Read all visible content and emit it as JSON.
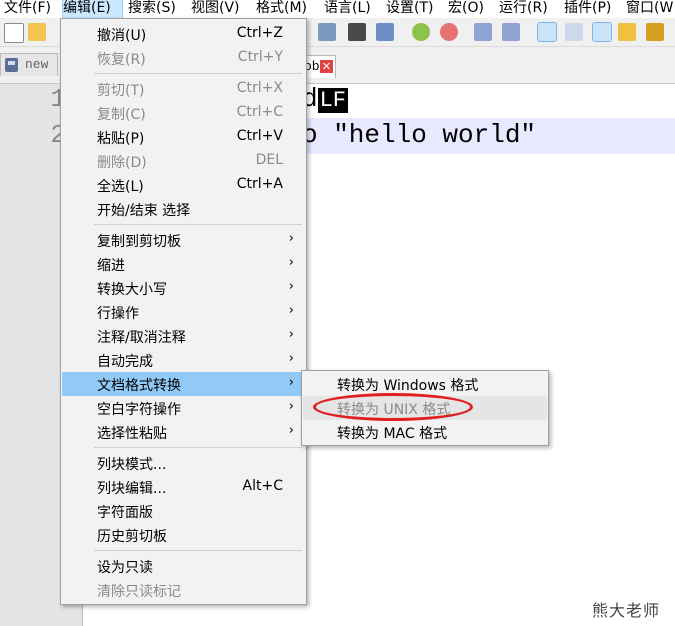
{
  "menubar": {
    "items": [
      {
        "label": "文件(F)"
      },
      {
        "label": "编辑(E)"
      },
      {
        "label": "搜索(S)"
      },
      {
        "label": "视图(V)"
      },
      {
        "label": "格式(M)"
      },
      {
        "label": "语言(L)"
      },
      {
        "label": "设置(T)"
      },
      {
        "label": "宏(O)"
      },
      {
        "label": "运行(R)"
      },
      {
        "label": "插件(P)"
      },
      {
        "label": "窗口(W"
      }
    ]
  },
  "tabs": {
    "first": "new",
    "second_visible": "ob"
  },
  "editor": {
    "line_numbers": [
      "1",
      "2"
    ],
    "line1_text": "d",
    "line1_eol": "LF",
    "line2_text": "o \"hello world\""
  },
  "edit_menu": {
    "items": [
      {
        "label": "撤消(U)",
        "shortcut": "Ctrl+Z"
      },
      {
        "label": "恢复(R)",
        "shortcut": "Ctrl+Y"
      },
      {
        "label": "剪切(T)",
        "shortcut": "Ctrl+X"
      },
      {
        "label": "复制(C)",
        "shortcut": "Ctrl+C"
      },
      {
        "label": "粘贴(P)",
        "shortcut": "Ctrl+V"
      },
      {
        "label": "删除(D)",
        "shortcut": "DEL"
      },
      {
        "label": "全选(L)",
        "shortcut": "Ctrl+A"
      },
      {
        "label": "开始/结束 选择"
      },
      {
        "label": "复制到剪切板"
      },
      {
        "label": "缩进"
      },
      {
        "label": "转换大小写"
      },
      {
        "label": "行操作"
      },
      {
        "label": "注释/取消注释"
      },
      {
        "label": "自动完成"
      },
      {
        "label": "文档格式转换"
      },
      {
        "label": "空白字符操作"
      },
      {
        "label": "选择性粘贴"
      },
      {
        "label": "列块模式..."
      },
      {
        "label": "列块编辑...",
        "shortcut": "Alt+C"
      },
      {
        "label": "字符面版"
      },
      {
        "label": "历史剪切板"
      },
      {
        "label": "设为只读"
      },
      {
        "label": "清除只读标记"
      }
    ],
    "submenu_arrow": "›"
  },
  "eol_submenu": {
    "items": [
      {
        "label": "转换为 Windows 格式"
      },
      {
        "label": "转换为 UNIX 格式"
      },
      {
        "label": "转换为 MAC 格式"
      }
    ]
  },
  "watermark": "熊大老师",
  "colors": {
    "menu_highlight": "#91c9f7",
    "menubar_active": "#cce8ff",
    "current_line": "#e8e8ff",
    "annotation_circle": "#e02020"
  }
}
